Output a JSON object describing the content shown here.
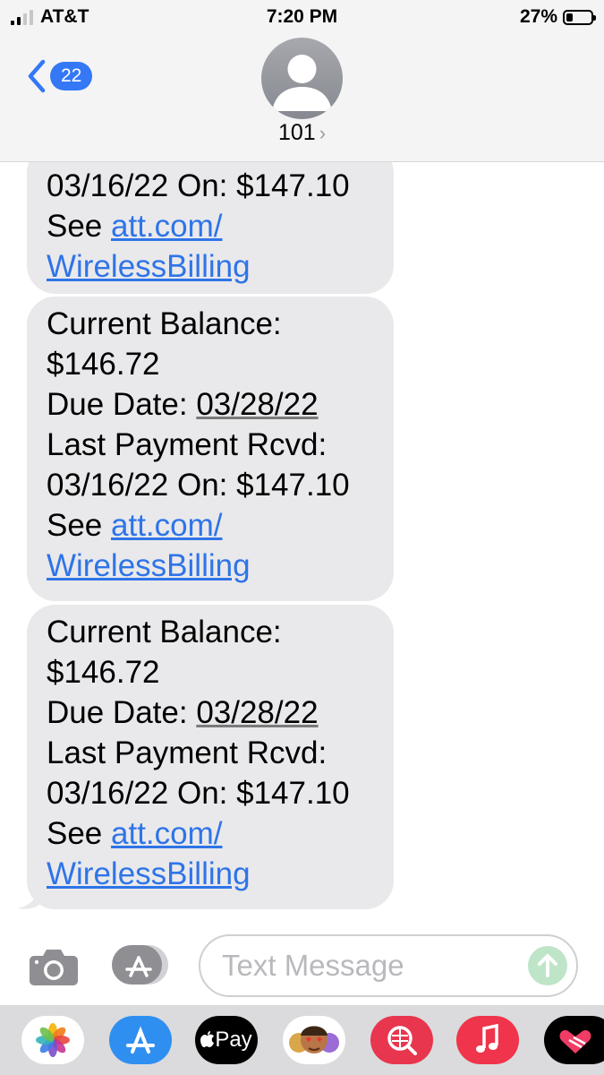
{
  "status_bar": {
    "carrier": "AT&T",
    "time": "7:20 PM",
    "battery_text": "27%",
    "battery_level": 0.27
  },
  "nav": {
    "back_count": "22",
    "contact_name": "101",
    "contact_chevron": "›"
  },
  "messages": [
    {
      "lines": [
        "03/16/22 On: $147.10"
      ],
      "see": "See ",
      "link1": "att.com/",
      "link2": "WirelessBilling"
    },
    {
      "lines": [
        "Current Balance:",
        "$146.72"
      ],
      "due_label": "Due Date: ",
      "due_date": "03/28/22",
      "last_payment": "Last Payment Rcvd:",
      "paid": "03/16/22 On: $147.10",
      "see": "See ",
      "link1": "att.com/",
      "link2": "WirelessBilling"
    },
    {
      "lines": [
        "Current Balance:",
        "$146.72"
      ],
      "due_label": "Due Date: ",
      "due_date": "03/28/22",
      "last_payment": "Last Payment Rcvd:",
      "paid": "03/16/22 On: $147.10",
      "see": "See ",
      "link1": "att.com/",
      "link2": "WirelessBilling"
    }
  ],
  "composer": {
    "placeholder": "Text Message"
  },
  "app_drawer": {
    "apps": [
      "photos-icon",
      "app-store-icon",
      "apple-pay-icon",
      "memoji-icon",
      "search-images-icon",
      "music-icon",
      "fitness-icon"
    ],
    "apple_pay_label": "Pay"
  },
  "colors": {
    "accent": "#3478f6",
    "bubble": "#e9e9eb",
    "link": "#2f74e8"
  }
}
